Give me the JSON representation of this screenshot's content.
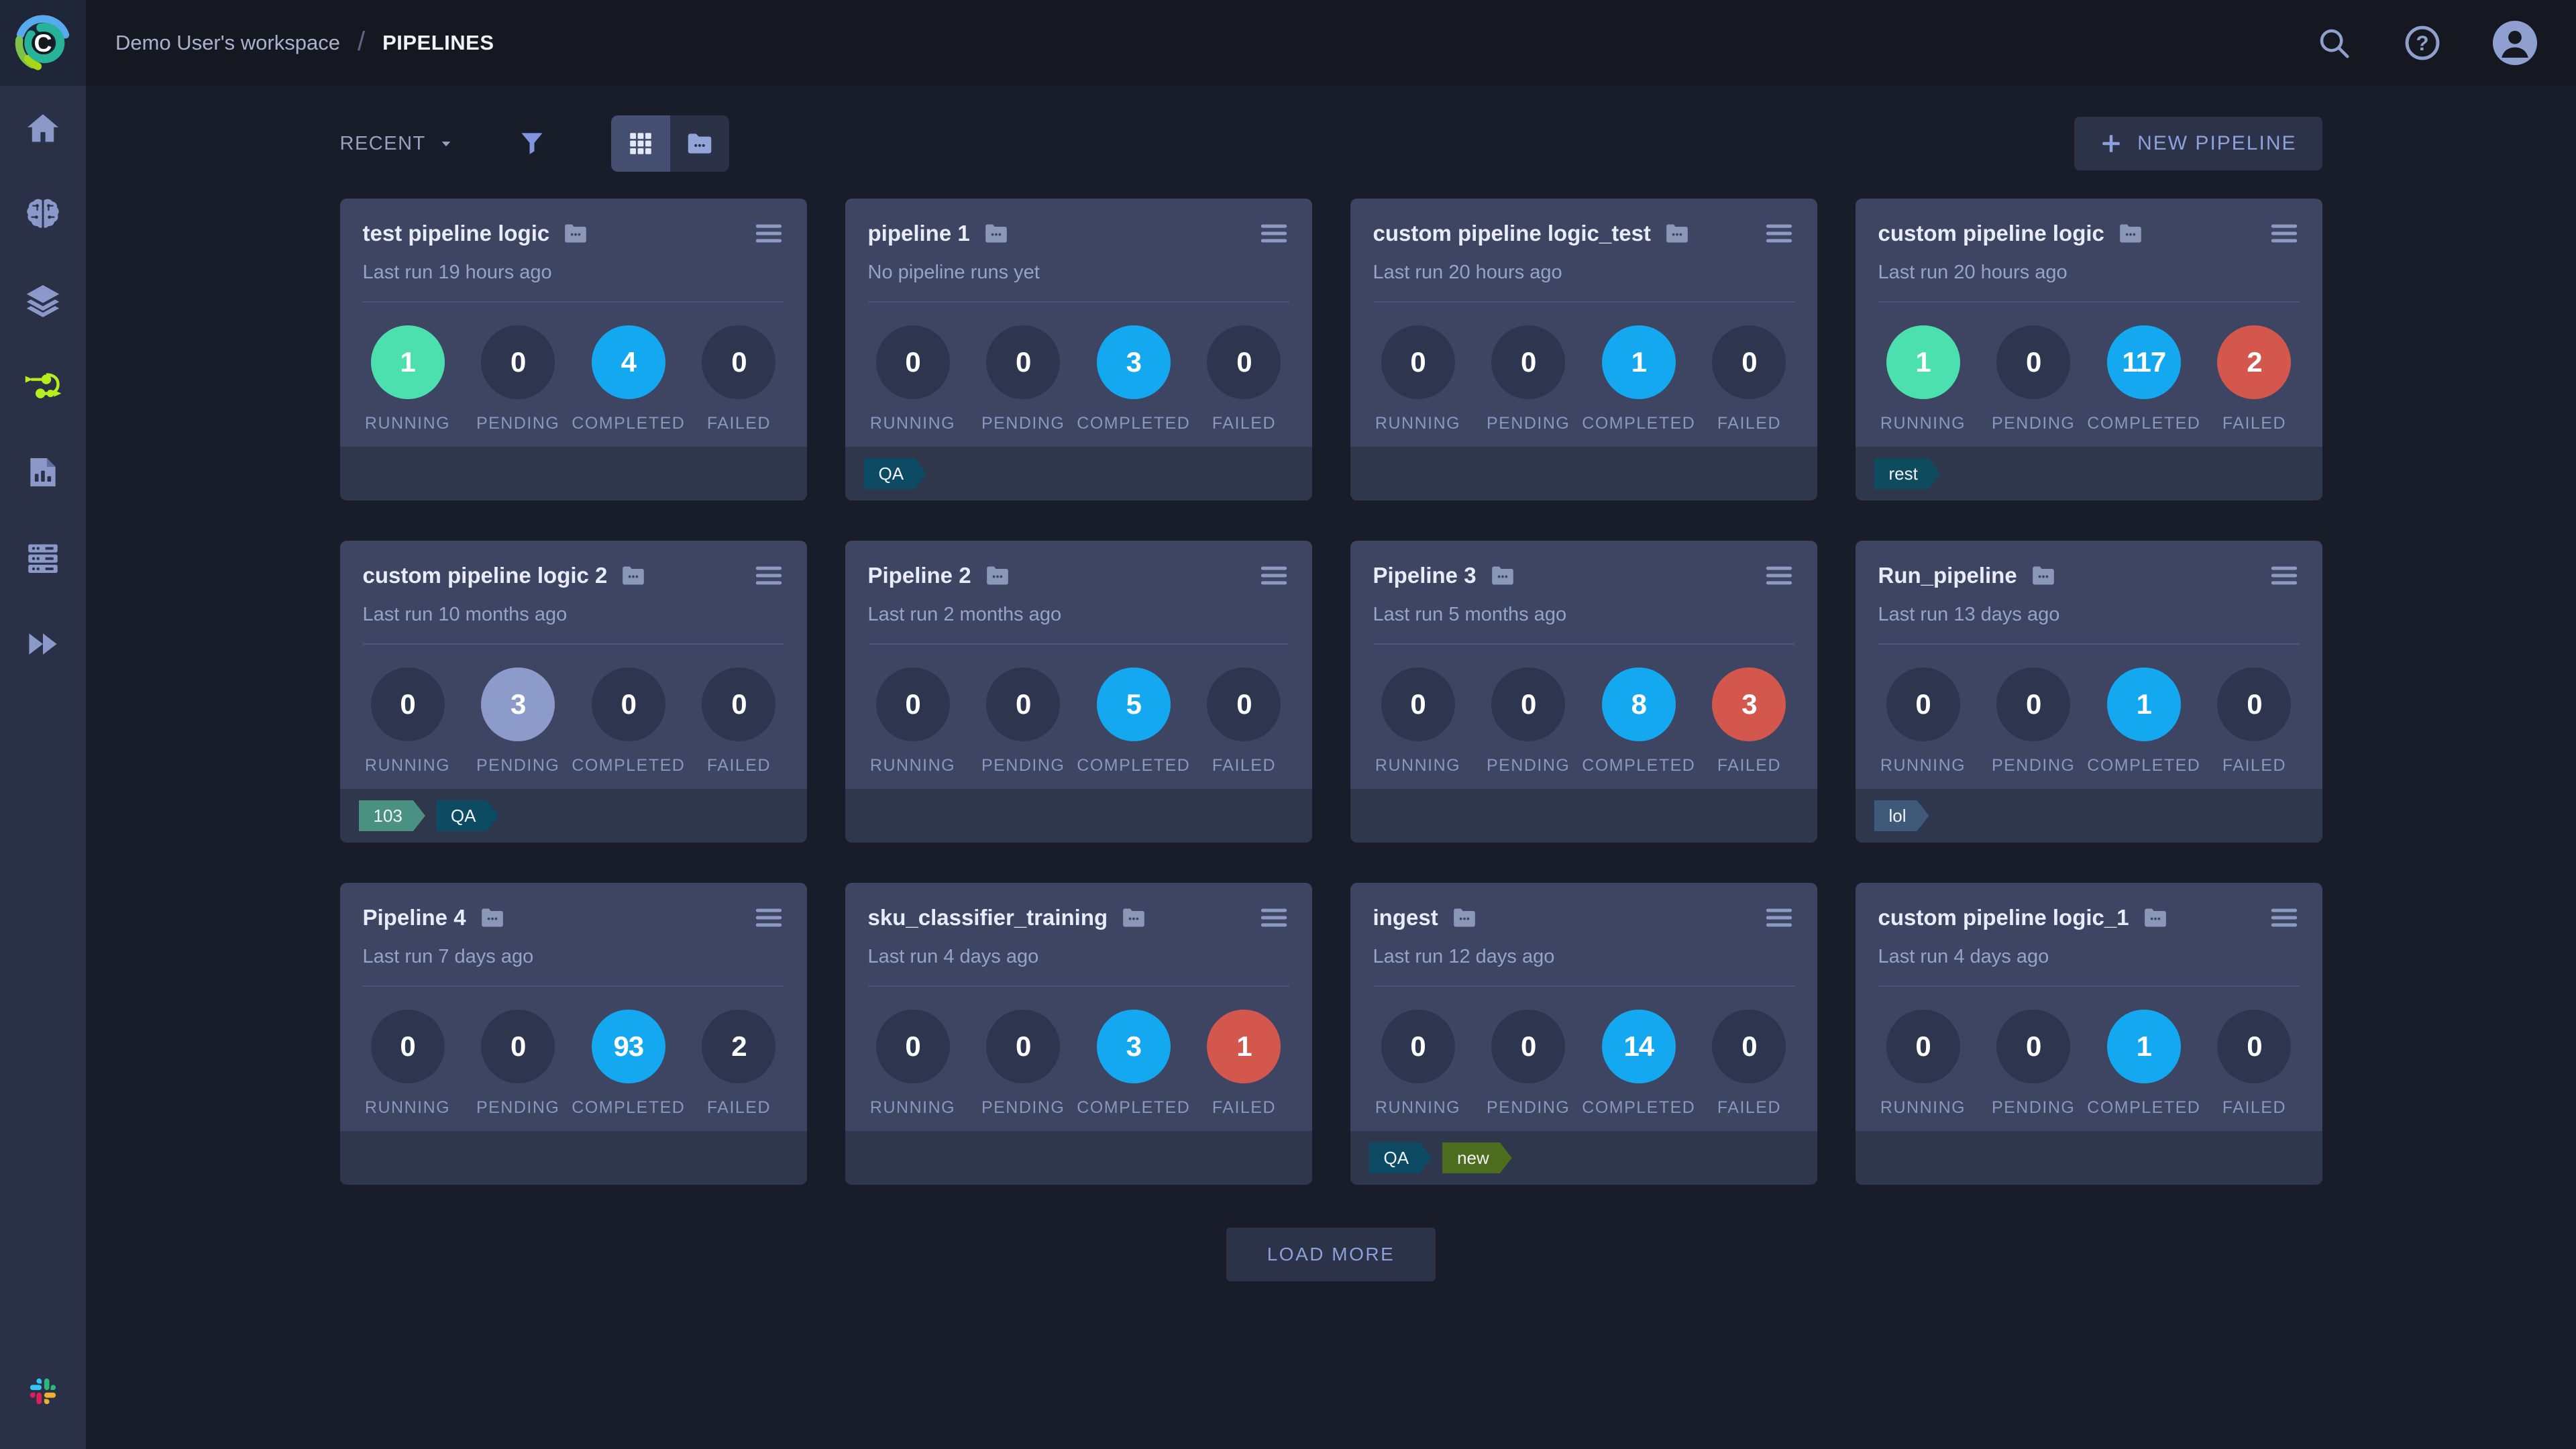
{
  "header": {
    "breadcrumb": {
      "workspace": "Demo User's workspace",
      "separator": "/",
      "page": "PIPELINES"
    },
    "icons": [
      "clearml-logo",
      "search",
      "help",
      "user-avatar"
    ]
  },
  "sidebar": {
    "items": [
      {
        "icon": "home",
        "active": false
      },
      {
        "icon": "projects-brain",
        "active": false
      },
      {
        "icon": "datasets-layers",
        "active": false
      },
      {
        "icon": "pipelines",
        "active": true
      },
      {
        "icon": "reports",
        "active": false
      },
      {
        "icon": "workers-queues",
        "active": false
      },
      {
        "icon": "applications",
        "active": false
      },
      {
        "icon": "slack",
        "active": false
      }
    ],
    "active_color": "#b5ee1e",
    "icon_color": "#8a99c9"
  },
  "toolbar": {
    "sort_label": "RECENT",
    "view_modes": [
      "grid-view",
      "folder-view"
    ],
    "active_view": "grid-view",
    "new_pipeline_plus": "+",
    "new_pipeline_label": "NEW PIPELINE"
  },
  "stat_labels": [
    "RUNNING",
    "PENDING",
    "COMPLETED",
    "FAILED"
  ],
  "status_colors": {
    "running": "#4ce0af",
    "pending": "#8d9bca",
    "completed": "#14a8f1",
    "failed": "#d4574e",
    "muted": "#2e364f"
  },
  "cards": [
    {
      "title": "test pipeline logic",
      "last_run": "Last run 19 hours ago",
      "stats": [
        {
          "value": "1",
          "variant": "running"
        },
        {
          "value": "0",
          "variant": "muted"
        },
        {
          "value": "4",
          "variant": "completed"
        },
        {
          "value": "0",
          "variant": "muted"
        }
      ],
      "tags": []
    },
    {
      "title": "pipeline 1",
      "last_run": "No pipeline runs yet",
      "stats": [
        {
          "value": "0",
          "variant": "muted"
        },
        {
          "value": "0",
          "variant": "muted"
        },
        {
          "value": "3",
          "variant": "completed"
        },
        {
          "value": "0",
          "variant": "muted"
        }
      ],
      "tags": [
        {
          "label": "QA",
          "color": "#0d4a63"
        }
      ]
    },
    {
      "title": "custom pipeline logic_test",
      "last_run": "Last run 20 hours ago",
      "stats": [
        {
          "value": "0",
          "variant": "muted"
        },
        {
          "value": "0",
          "variant": "muted"
        },
        {
          "value": "1",
          "variant": "completed"
        },
        {
          "value": "0",
          "variant": "muted"
        }
      ],
      "tags": []
    },
    {
      "title": "custom pipeline logic",
      "last_run": "Last run 20 hours ago",
      "stats": [
        {
          "value": "1",
          "variant": "running"
        },
        {
          "value": "0",
          "variant": "muted"
        },
        {
          "value": "117",
          "variant": "completed"
        },
        {
          "value": "2",
          "variant": "failed"
        }
      ],
      "tags": [
        {
          "label": "rest",
          "color": "#0f4b5e"
        }
      ]
    },
    {
      "title": "custom pipeline logic 2",
      "last_run": "Last run 10 months ago",
      "stats": [
        {
          "value": "0",
          "variant": "muted"
        },
        {
          "value": "3",
          "variant": "pending"
        },
        {
          "value": "0",
          "variant": "muted"
        },
        {
          "value": "0",
          "variant": "muted"
        }
      ],
      "tags": [
        {
          "label": "103",
          "color": "#4a9181"
        },
        {
          "label": "QA",
          "color": "#0d4a63"
        }
      ]
    },
    {
      "title": "Pipeline 2",
      "last_run": "Last run 2 months ago",
      "stats": [
        {
          "value": "0",
          "variant": "muted"
        },
        {
          "value": "0",
          "variant": "muted"
        },
        {
          "value": "5",
          "variant": "completed"
        },
        {
          "value": "0",
          "variant": "muted"
        }
      ],
      "tags": []
    },
    {
      "title": "Pipeline 3",
      "last_run": "Last run 5 months ago",
      "stats": [
        {
          "value": "0",
          "variant": "muted"
        },
        {
          "value": "0",
          "variant": "muted"
        },
        {
          "value": "8",
          "variant": "completed"
        },
        {
          "value": "3",
          "variant": "failed"
        }
      ],
      "tags": []
    },
    {
      "title": "Run_pipeline",
      "last_run": "Last run 13 days ago",
      "stats": [
        {
          "value": "0",
          "variant": "muted"
        },
        {
          "value": "0",
          "variant": "muted"
        },
        {
          "value": "1",
          "variant": "completed"
        },
        {
          "value": "0",
          "variant": "muted"
        }
      ],
      "tags": [
        {
          "label": "lol",
          "color": "#3e5a78"
        }
      ]
    },
    {
      "title": "Pipeline 4",
      "last_run": "Last run 7 days ago",
      "stats": [
        {
          "value": "0",
          "variant": "muted"
        },
        {
          "value": "0",
          "variant": "muted"
        },
        {
          "value": "93",
          "variant": "completed"
        },
        {
          "value": "2",
          "variant": "muted"
        }
      ],
      "tags": []
    },
    {
      "title": "sku_classifier_training",
      "last_run": "Last run 4 days ago",
      "stats": [
        {
          "value": "0",
          "variant": "muted"
        },
        {
          "value": "0",
          "variant": "muted"
        },
        {
          "value": "3",
          "variant": "completed"
        },
        {
          "value": "1",
          "variant": "failed"
        }
      ],
      "tags": []
    },
    {
      "title": "ingest",
      "last_run": "Last run 12 days ago",
      "stats": [
        {
          "value": "0",
          "variant": "muted"
        },
        {
          "value": "0",
          "variant": "muted"
        },
        {
          "value": "14",
          "variant": "completed"
        },
        {
          "value": "0",
          "variant": "muted"
        }
      ],
      "tags": [
        {
          "label": "QA",
          "color": "#0d4a63"
        },
        {
          "label": "new",
          "color": "#4c6c1e"
        }
      ]
    },
    {
      "title": "custom pipeline logic_1",
      "last_run": "Last run 4 days ago",
      "stats": [
        {
          "value": "0",
          "variant": "muted"
        },
        {
          "value": "0",
          "variant": "muted"
        },
        {
          "value": "1",
          "variant": "completed"
        },
        {
          "value": "0",
          "variant": "muted"
        }
      ],
      "tags": []
    }
  ],
  "footer": {
    "load_more_label": "LOAD MORE"
  }
}
